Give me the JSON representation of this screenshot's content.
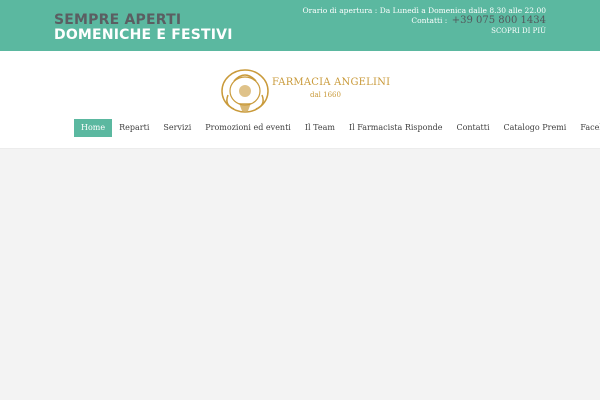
{
  "topbar": {
    "tagline_line1": "SEMPRE APERTI",
    "tagline_line2": "DOMENICHE E FESTIVI",
    "hours": "Orario di apertura : Da Lunedì a Domenica dalle 8.30 alle 22.00",
    "contact_label": "Contatti :",
    "phone": "+39 075 800 1434",
    "more_link": "SCOPRI DI PIÙ"
  },
  "logo": {
    "name": "FARMACIA ANGELINI",
    "since": "dal 1660",
    "icon": "crest-icon"
  },
  "nav": {
    "items": [
      {
        "label": "Home",
        "active": true
      },
      {
        "label": "Reparti"
      },
      {
        "label": "Servizi"
      },
      {
        "label": "Promozioni ed eventi"
      },
      {
        "label": "Il Team"
      },
      {
        "label": "Il Farmacista Risponde"
      },
      {
        "label": "Contatti"
      },
      {
        "label": "Catalogo Premi"
      },
      {
        "label": "Facebook"
      }
    ]
  },
  "colors": {
    "accent": "#5bb8a0",
    "gold": "#c99a3a",
    "tagline_gray": "#5b5e62"
  }
}
